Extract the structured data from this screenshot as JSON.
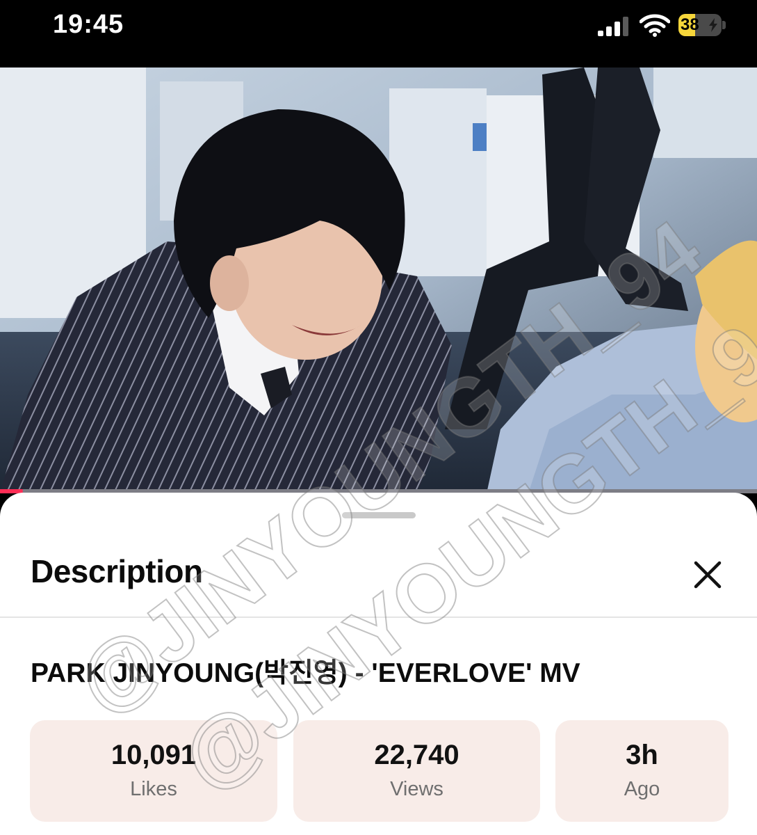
{
  "status_bar": {
    "time": "19:45",
    "battery_level": "38",
    "battery_percent": 38,
    "signal_bars_active": 3
  },
  "video": {
    "progress_fraction": 0.03,
    "progress_color": "#ff2d55"
  },
  "sheet": {
    "title": "Description",
    "video_title": "PARK JINYOUNG(박진영) - 'EVERLOVE' MV",
    "stats": [
      {
        "value": "10,091",
        "label": "Likes"
      },
      {
        "value": "22,740",
        "label": "Views"
      },
      {
        "value": "3h",
        "label": "Ago"
      }
    ]
  },
  "watermark": {
    "text": "@JINYOUNGTH_94"
  },
  "colors": {
    "card_bg": "#f8ece8",
    "battery_fill": "#f6d63a"
  },
  "icons": {
    "close": "close-icon",
    "wifi": "wifi-icon",
    "signal": "cellular-signal-icon",
    "battery": "battery-icon"
  }
}
